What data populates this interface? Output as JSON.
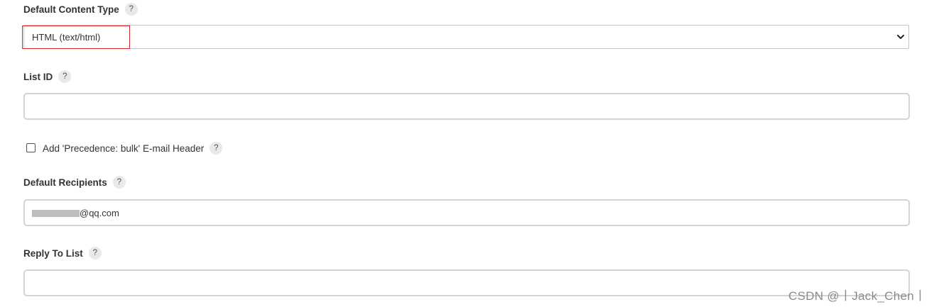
{
  "fields": {
    "content_type": {
      "label": "Default Content Type",
      "help": "?",
      "selected": "HTML (text/html)"
    },
    "list_id": {
      "label": "List ID",
      "help": "?",
      "value": ""
    },
    "precedence": {
      "label": "Add 'Precedence: bulk' E-mail Header",
      "help": "?",
      "checked": false
    },
    "recipients": {
      "label": "Default Recipients",
      "help": "?",
      "value_visible": "@qq.com"
    },
    "reply_to": {
      "label": "Reply To List",
      "help": "?",
      "value": ""
    }
  },
  "watermark": "CSDN @丨Jack_Chen丨",
  "colors": {
    "highlight": "#d9262e",
    "input_border": "#cfd5d9",
    "help_bg": "#e9e9e9"
  },
  "icons": {
    "select_arrow": "chevron-down-icon"
  }
}
